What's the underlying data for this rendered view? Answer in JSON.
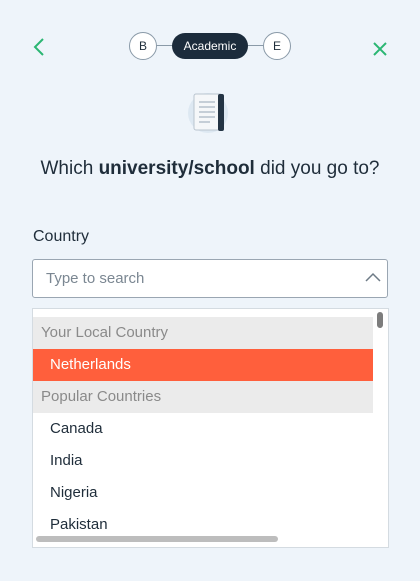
{
  "stepper": {
    "step_prev": "B",
    "step_current": "Academic",
    "step_next": "E"
  },
  "icons": {
    "back": "chevron-left-icon",
    "close": "close-icon",
    "document": "document-icon",
    "dropdown_toggle": "chevron-up-icon"
  },
  "question": {
    "prefix": "Which ",
    "emphasis": "university/school",
    "suffix": " did you go to?"
  },
  "country_field": {
    "label": "Country",
    "value": "",
    "placeholder": "Type to search"
  },
  "dropdown": {
    "groups": [
      {
        "header": "Your Local Country",
        "options": [
          "Netherlands"
        ]
      },
      {
        "header": "Popular Countries",
        "options": [
          "Canada",
          "India",
          "Nigeria",
          "Pakistan"
        ]
      }
    ],
    "selected": "Netherlands"
  },
  "colors": {
    "background": "#eef4fa",
    "accent": "#ff5f3c",
    "dark": "#1c2c3c",
    "icon_green": "#2bb673"
  }
}
